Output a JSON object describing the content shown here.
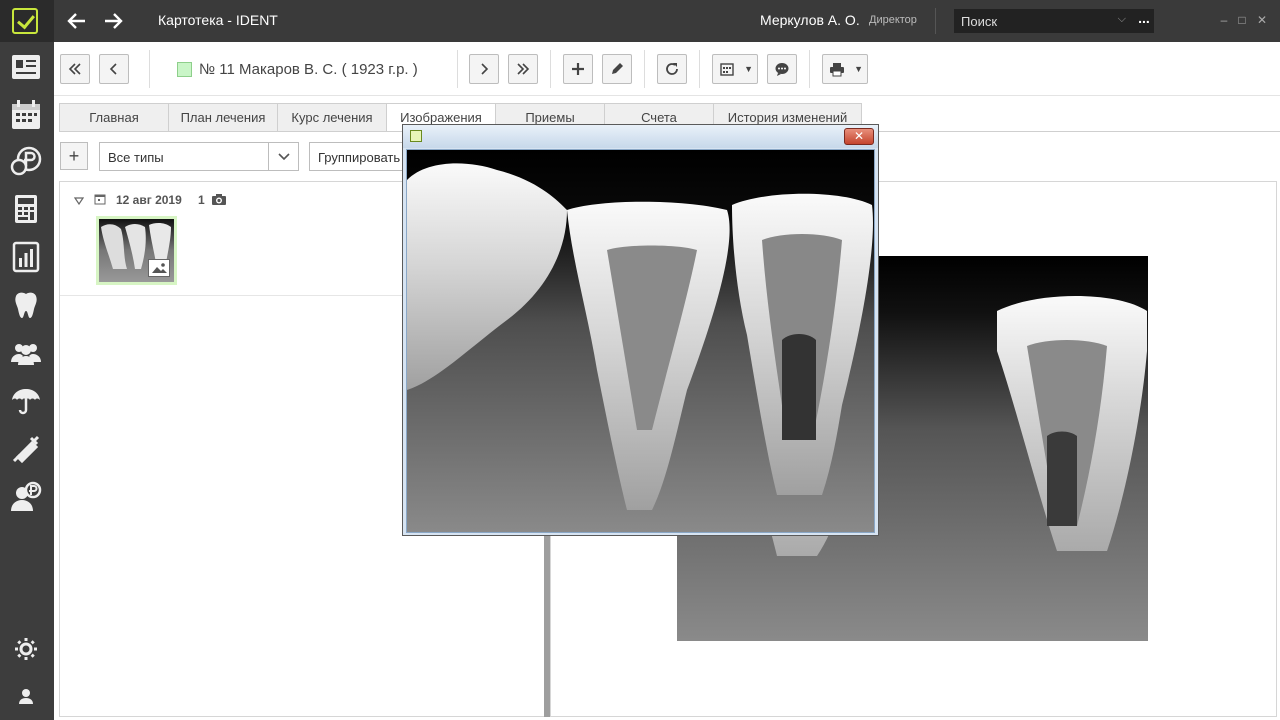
{
  "titlebar": {
    "app_title": "Картотека - IDENT",
    "user_name": "Меркулов А. О.",
    "user_role": "Директор",
    "search_value": "Поиск",
    "search_more": "...",
    "minimize": "–",
    "maximize": "□",
    "close": "✕"
  },
  "toolbar": {
    "patient": "№ 11 Макаров В. С. ( 1923 г.р. )",
    "patient_color": "#c9f5c7"
  },
  "tabs": [
    {
      "label": "Главная"
    },
    {
      "label": "План лечения"
    },
    {
      "label": "Курс лечения"
    },
    {
      "label": "Изображения"
    },
    {
      "label": "Приемы"
    },
    {
      "label": "Счета"
    },
    {
      "label": "История изменений"
    }
  ],
  "filters": {
    "add": "+",
    "types_value": "Все типы",
    "group_value": "Группировать"
  },
  "image_group": {
    "date": "12 авг 2019",
    "count": "1"
  },
  "colors": {
    "accent": "#c8e63c",
    "sidebar": "#3d3d3d",
    "titlebar": "#3a3a3a"
  }
}
